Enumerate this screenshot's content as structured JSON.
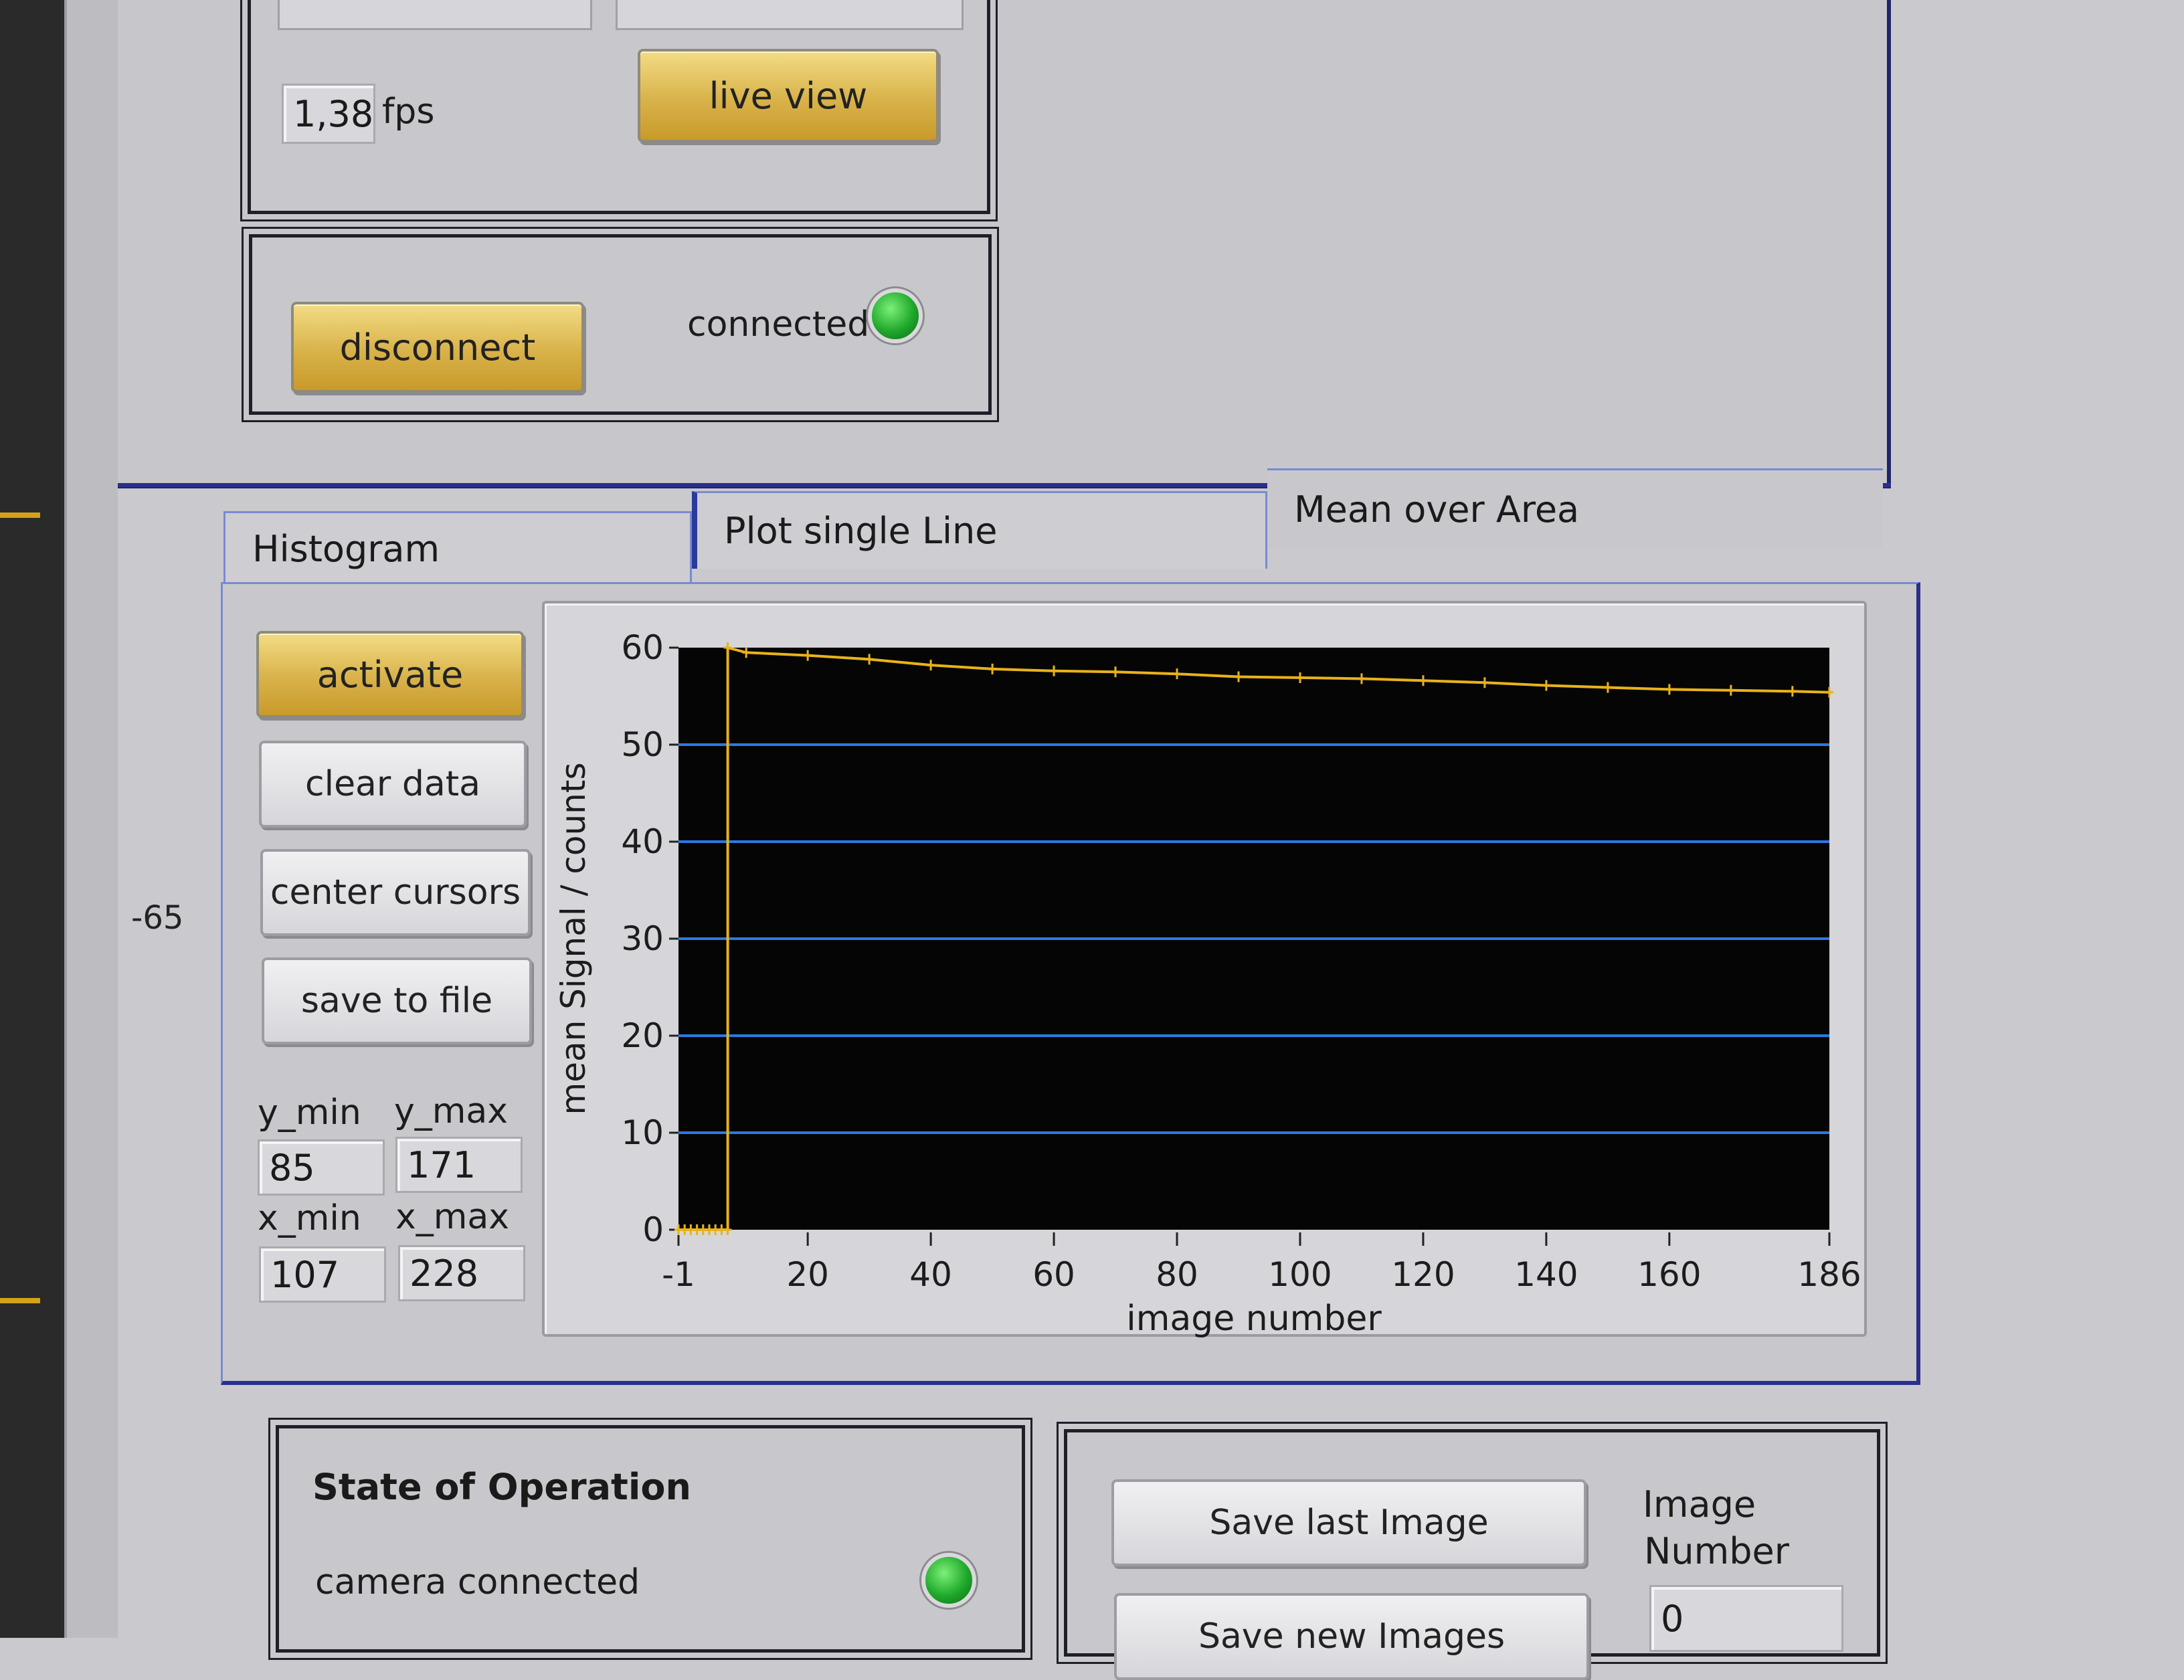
{
  "side_value": "-65",
  "camera": {
    "fps_value": "1,38",
    "fps_unit": "fps",
    "live_view_label": "live view"
  },
  "connection": {
    "disconnect_label": "disconnect",
    "connected_label": "connected",
    "led_color": "#22b02c"
  },
  "tabs": [
    {
      "label": "Histogram"
    },
    {
      "label": "Plot single Line"
    },
    {
      "label": "Mean over Area"
    }
  ],
  "mean_panel": {
    "activate_label": "activate",
    "clear_label": "clear data",
    "center_label": "center cursors",
    "save_label": "save to file",
    "y_min_label": "y_min",
    "y_max_label": "y_max",
    "x_min_label": "x_min",
    "x_max_label": "x_max",
    "y_min": "85",
    "y_max": "171",
    "x_min": "107",
    "x_max": "228"
  },
  "chart_data": {
    "type": "line",
    "xlabel": "image number",
    "ylabel": "mean Signal / counts",
    "xlim": [
      -1,
      186
    ],
    "ylim": [
      0,
      60
    ],
    "x_ticks": [
      "-1",
      "20",
      "40",
      "60",
      "80",
      "100",
      "120",
      "140",
      "160",
      "186"
    ],
    "y_ticks": [
      "0",
      "10",
      "20",
      "30",
      "40",
      "50",
      "60"
    ],
    "grid": "horizontal",
    "background": "#050505",
    "grid_color": "#2a7ae0",
    "line_color": "#e8b21a",
    "series": [
      {
        "x": [
          -1,
          0,
          1,
          2,
          3,
          4,
          5,
          6,
          7,
          7,
          10,
          20,
          30,
          40,
          50,
          60,
          70,
          80,
          90,
          100,
          110,
          120,
          130,
          140,
          150,
          160,
          170,
          180,
          186
        ],
        "y": [
          0,
          0,
          0,
          0,
          0,
          0,
          0,
          0,
          0,
          60,
          59.5,
          59.2,
          58.8,
          58.2,
          57.8,
          57.6,
          57.5,
          57.3,
          57.0,
          56.9,
          56.8,
          56.6,
          56.4,
          56.1,
          55.9,
          55.7,
          55.6,
          55.5,
          55.4
        ]
      }
    ]
  },
  "state": {
    "title": "State of Operation",
    "camera_connected_label": "camera connected",
    "led_color": "#22b02c"
  },
  "save": {
    "save_last_label": "Save last Image",
    "save_new_label": "Save new Images",
    "image_number_label_1": "Image",
    "image_number_label_2": "Number",
    "image_number_value": "0"
  }
}
